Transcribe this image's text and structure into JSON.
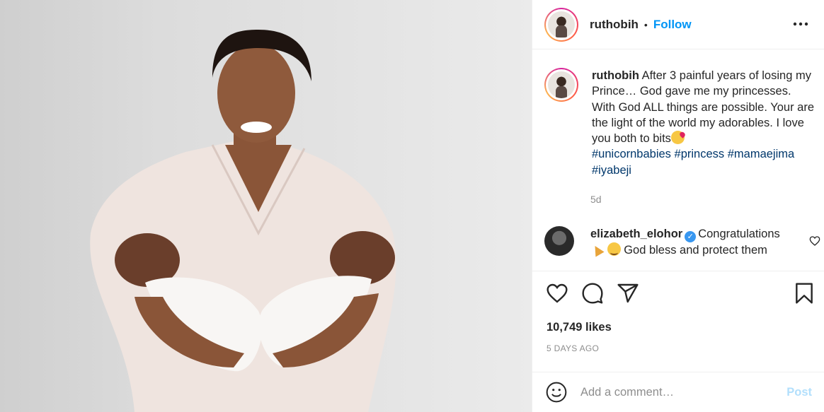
{
  "header": {
    "username": "ruthobih",
    "separator": "•",
    "follow_label": "Follow",
    "more_icon": "more-horizontal-icon"
  },
  "caption": {
    "username": "ruthobih",
    "text": " After 3 painful years of losing my Prince… God gave me my princesses. With God ALL things are possible. Your are the light of the world my adorables. I love you both to bits",
    "hashtags": [
      "#unicornbabies",
      "#princess",
      "#mamaejima",
      "#iyabeji"
    ],
    "age": "5d"
  },
  "comment": {
    "username": "elizabeth_elohor",
    "verified_icon": "verified-badge-icon",
    "text_1": "Congratulations",
    "text_2": "God bless and protect them"
  },
  "actions": {
    "like_icon": "heart-icon",
    "comment_icon": "comment-bubble-icon",
    "share_icon": "share-plane-icon",
    "save_icon": "bookmark-icon"
  },
  "likes": "10,749 likes",
  "date": "5 DAYS AGO",
  "add_comment": {
    "placeholder": "Add a comment…",
    "post_label": "Post"
  },
  "colors": {
    "link_blue": "#0095f6",
    "hashtag": "#00376b",
    "muted": "#8e8e8e",
    "post_disabled": "#b2dffc"
  }
}
